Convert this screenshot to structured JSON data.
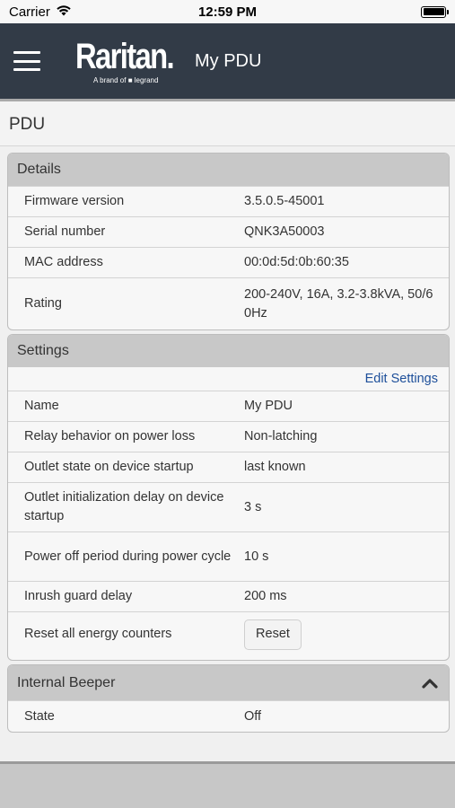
{
  "status_bar": {
    "carrier": "Carrier",
    "time": "12:59 PM"
  },
  "header": {
    "logo_text": "Raritan.",
    "logo_sub": "A brand of ■ legrand",
    "title": "My PDU"
  },
  "page": {
    "title": "PDU"
  },
  "details": {
    "heading": "Details",
    "rows": [
      {
        "label": "Firmware version",
        "value": "3.5.0.5-45001"
      },
      {
        "label": "Serial number",
        "value": "QNK3A50003"
      },
      {
        "label": "MAC address",
        "value": "00:0d:5d:0b:60:35"
      },
      {
        "label": "Rating",
        "value": "200-240V, 16A, 3.2-3.8kVA, 50/60Hz"
      }
    ]
  },
  "settings": {
    "heading": "Settings",
    "edit_label": "Edit Settings",
    "rows": [
      {
        "label": "Name",
        "value": "My PDU"
      },
      {
        "label": "Relay behavior on power loss",
        "value": "Non-latching"
      },
      {
        "label": "Outlet state on device startup",
        "value": "last known"
      },
      {
        "label": "Outlet initialization delay on device startup",
        "value": "3 s"
      },
      {
        "label": "Power off period during power cycle",
        "value": "10 s"
      },
      {
        "label": "Inrush guard delay",
        "value": "200 ms"
      }
    ],
    "reset_label": "Reset all energy counters",
    "reset_button": "Reset"
  },
  "beeper": {
    "heading": "Internal Beeper",
    "rows": [
      {
        "label": "State",
        "value": "Off"
      }
    ]
  },
  "icons": {
    "menu": "menu-icon",
    "wifi": "wifi-icon",
    "battery": "battery-icon",
    "collapse": "chevron-up-icon"
  }
}
